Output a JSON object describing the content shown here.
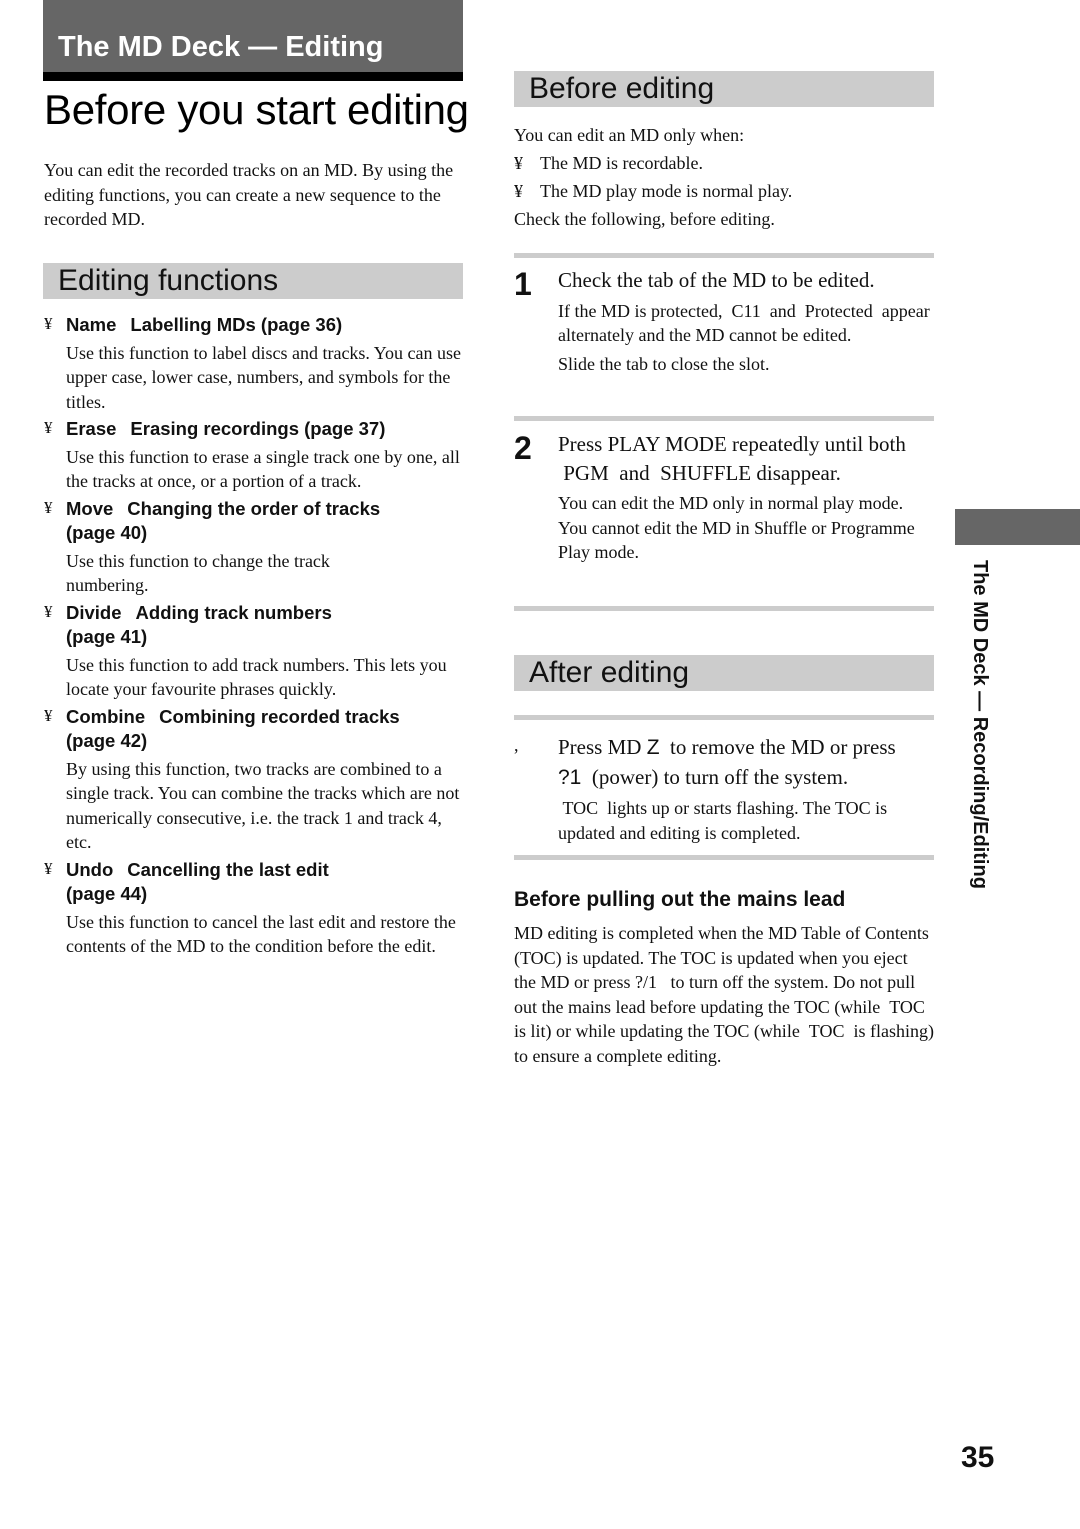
{
  "header": {
    "chapter": "The MD Deck — Editing",
    "page_title": "Before you start editing"
  },
  "intro": "You can edit the recorded tracks on an MD. By using the editing functions, you can create a new sequence to the recorded MD.",
  "editing_functions": {
    "heading": "Editing functions",
    "bullet_glyph": "¥",
    "items": [
      {
        "name": "Name",
        "title": "Labelling MDs (page 36)",
        "desc": "Use this function to label discs and tracks. You can use upper case, lower case, numbers, and symbols for the titles."
      },
      {
        "name": "Erase",
        "title": "Erasing recordings (page 37)",
        "desc": "Use this function to erase a single track one by one, all the tracks at once, or a portion of a track."
      },
      {
        "name": "Move",
        "title": "Changing the order of tracks (page 40)",
        "desc": "Use this function to change the track numbering."
      },
      {
        "name": "Divide",
        "title": "Adding track numbers (page 41)",
        "desc": "Use this function to add track numbers. This lets you locate your favourite phrases quickly."
      },
      {
        "name": "Combine",
        "title": "Combining recorded tracks (page 42)",
        "desc": "By using this function, two tracks are combined to a single track. You can combine the tracks which are not numerically consecutive, i.e. the track 1 and track 4, etc."
      },
      {
        "name": "Undo",
        "title": "Cancelling the last edit (page 44)",
        "desc": "Use this function to cancel the last edit and restore the contents of the MD to the condition before the edit."
      }
    ]
  },
  "before_editing": {
    "heading": "Before editing",
    "lead": "You can edit an MD only when:",
    "bullets": [
      "The MD is recordable.",
      "The MD play mode is normal play."
    ],
    "follow": "Check the following, before editing.",
    "steps": [
      {
        "num": "1",
        "main": "Check the tab of the MD to be edited.",
        "notes": [
          "If the MD is protected,  C11  and  Protected  appear alternately and the MD cannot be edited.",
          "Slide the tab to close the slot."
        ]
      },
      {
        "num": "2",
        "main": "Press PLAY MODE repeatedly until both  PGM  and  SHUFFLE disappear.",
        "notes": [
          "You can edit the MD only in normal play mode. You cannot edit the MD in Shuffle or Programme Play mode."
        ]
      }
    ]
  },
  "after_editing": {
    "heading": "After editing",
    "step_marker": ",",
    "main_1": "Press MD ",
    "eject_glyph": "Z",
    "main_2": "  to remove the MD or press",
    "power_glyph": "?1",
    "main_3": "  (power) to turn off the system.",
    "note": " TOC  lights up or starts flashing. The TOC is updated and editing is completed."
  },
  "mains_lead": {
    "heading": "Before pulling out the mains lead",
    "body": "MD editing is completed when the MD Table of Contents (TOC) is updated. The TOC is updated when you eject the MD or press ?/1   to turn off the system. Do not pull out the mains lead before updating the TOC (while  TOC  is lit) or while updating the TOC (while  TOC  is flashing) to ensure a complete editing."
  },
  "side_tab": "The MD Deck — Recording/Editing",
  "page_number": "35"
}
